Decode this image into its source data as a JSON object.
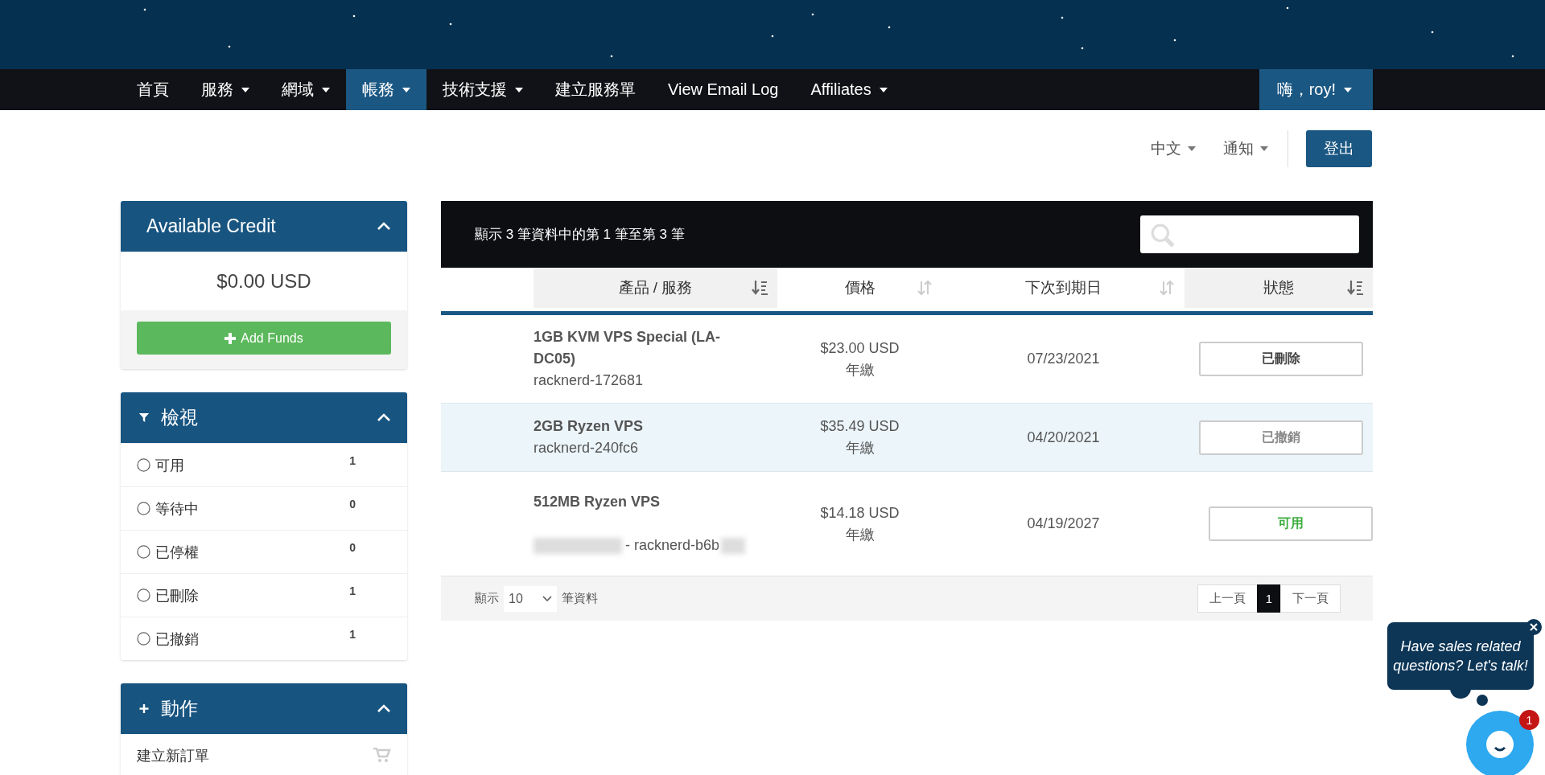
{
  "nav": {
    "items": [
      {
        "label": "首頁",
        "dropdown": false,
        "selected": false
      },
      {
        "label": "服務",
        "dropdown": true,
        "selected": false
      },
      {
        "label": "網域",
        "dropdown": true,
        "selected": false
      },
      {
        "label": "帳務",
        "dropdown": true,
        "selected": true
      },
      {
        "label": "技術支援",
        "dropdown": true,
        "selected": false
      },
      {
        "label": "建立服務單",
        "dropdown": false,
        "selected": false
      },
      {
        "label": "View Email Log",
        "dropdown": false,
        "selected": false
      },
      {
        "label": "Affiliates",
        "dropdown": true,
        "selected": false
      }
    ],
    "user_menu": {
      "label": "嗨，roy!",
      "dropdown": true
    }
  },
  "toolbar": {
    "language": "中文",
    "notifications": "通知",
    "logout": "登出"
  },
  "sidebar": {
    "panels": [
      {
        "kind": "credit",
        "title": "Available Credit",
        "expanded": true,
        "amount": "$0.00 USD",
        "button": "Add Funds"
      },
      {
        "kind": "filter",
        "title": "檢視",
        "expanded": true,
        "items": [
          {
            "label": "可用",
            "count": "1",
            "checked": false
          },
          {
            "label": "等待中",
            "count": "0",
            "checked": false
          },
          {
            "label": "已停權",
            "count": "0",
            "checked": false
          },
          {
            "label": "已刪除",
            "count": "1",
            "checked": false
          },
          {
            "label": "已撤銷",
            "count": "1",
            "checked": false
          }
        ]
      },
      {
        "kind": "actions",
        "title": "動作",
        "expanded": true,
        "items": [
          {
            "label": "建立新訂單"
          }
        ]
      }
    ]
  },
  "table": {
    "info": "顯示 3 筆資料中的第 1 筆至第 3 筆",
    "columns": [
      {
        "label": "產品 / 服務",
        "sorted": true
      },
      {
        "label": "價格",
        "sorted": false
      },
      {
        "label": "下次到期日",
        "sorted": false
      },
      {
        "label": "狀態",
        "sorted": true
      }
    ],
    "rows": [
      {
        "product": "1GB KVM VPS Special (LA-DC05)",
        "domain": "racknerd-172681",
        "redacted": false,
        "price": "$23.00 USD",
        "cycle": "年繳",
        "due": "07/23/2021",
        "status": {
          "label": "已刪除",
          "kind": "deleted"
        },
        "highlighted": false
      },
      {
        "product": "2GB Ryzen VPS",
        "domain": "racknerd-240fc6",
        "redacted": false,
        "price": "$35.49 USD",
        "cycle": "年繳",
        "due": "04/20/2021",
        "status": {
          "label": "已撤銷",
          "kind": "cancelled"
        },
        "highlighted": true
      },
      {
        "product": "512MB Ryzen VPS",
        "domain": "- racknerd-b6b",
        "redacted": true,
        "price": "$14.18 USD",
        "cycle": "年繳",
        "due": "04/19/2027",
        "status": {
          "label": "可用",
          "kind": "active"
        },
        "highlighted": false
      }
    ],
    "footer": {
      "label_before": "顯示",
      "page_size": "10",
      "label_after": "筆資料",
      "pagination": [
        {
          "label": "上一頁",
          "selected": false
        },
        {
          "label": "1",
          "selected": true
        },
        {
          "label": "下一頁",
          "selected": false
        }
      ]
    }
  },
  "chat": {
    "message": "Have sales related questions? Let's talk!",
    "badge": "1"
  }
}
